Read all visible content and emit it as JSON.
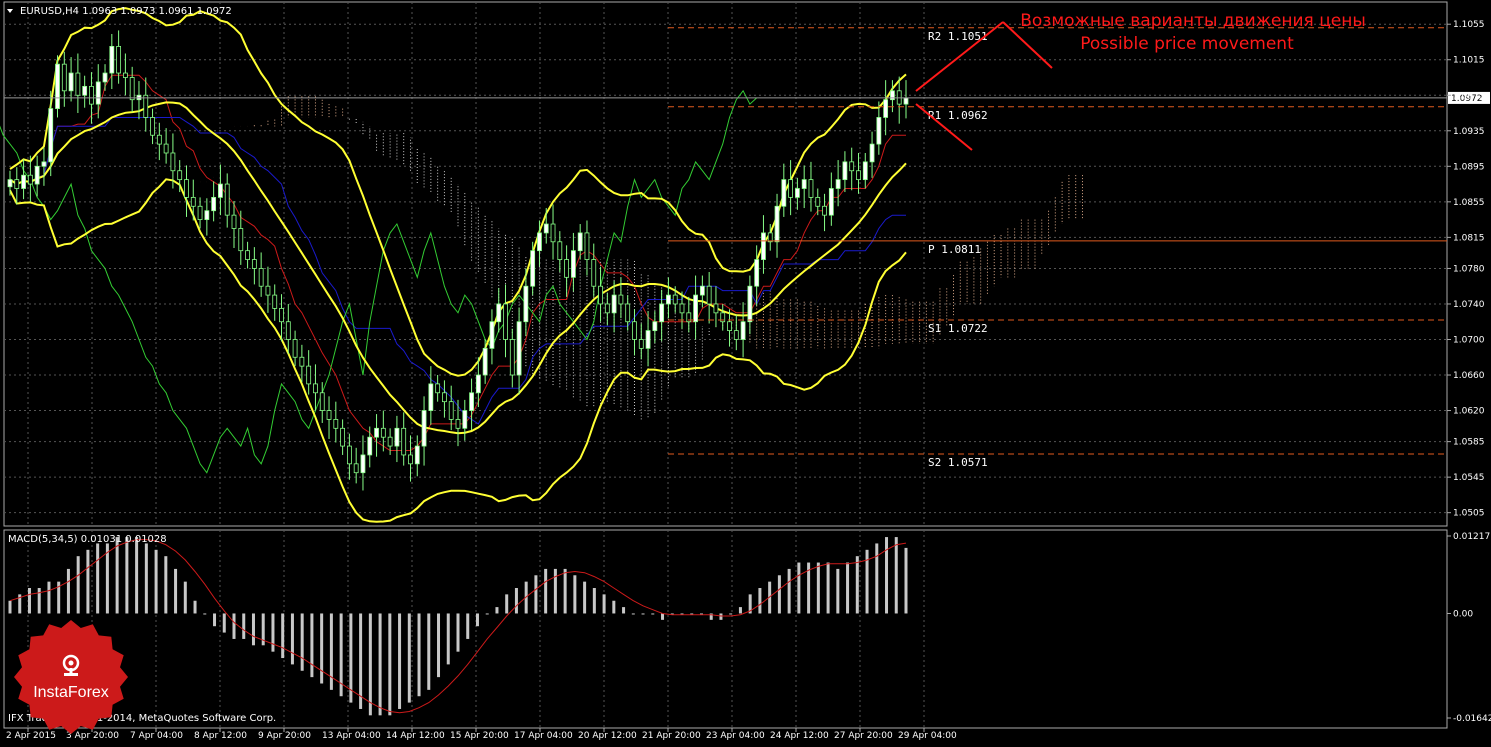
{
  "window": {
    "title": "EURUSD,H4  1.0963 1.0973 1.0961 1.0972",
    "copyright": "IFX Trader, © 2001-2014, MetaQuotes Software Corp."
  },
  "annotation": {
    "line1": "Возможные варианты движения цены",
    "line2": "Possible price movement",
    "color": "#ff1a1a"
  },
  "pivots": [
    {
      "label": "R2",
      "value": "1.1051",
      "price": 1.1051,
      "color": "#e05a1e",
      "style": "dash"
    },
    {
      "label": "R1",
      "value": "1.0962",
      "price": 1.0962,
      "color": "#e05a1e",
      "style": "dash"
    },
    {
      "label": "P",
      "value": "1.0811",
      "price": 1.0811,
      "color": "#e05a1e",
      "style": "solid"
    },
    {
      "label": "S1",
      "value": "1.0722",
      "price": 1.0722,
      "color": "#e05a1e",
      "style": "dash"
    },
    {
      "label": "S2",
      "value": "1.0571",
      "price": 1.0571,
      "color": "#e05a1e",
      "style": "dash"
    }
  ],
  "current_price": "1.0972",
  "macd": {
    "label": "MACD(5,34,5) 0.01031 0.01028",
    "y_ticks": [
      "0.01217",
      "0.00",
      "-0.01642"
    ]
  },
  "logo": {
    "text": "InstaForex",
    "color": "#cc1a1a"
  },
  "chart_data": {
    "type": "candlestick",
    "symbol": "EURUSD",
    "timeframe": "H4",
    "ylim": [
      1.049,
      1.108
    ],
    "y_ticks": [
      "1.1055",
      "1.1015",
      "1.0975",
      "1.0935",
      "1.0895",
      "1.0855",
      "1.0815",
      "1.0780",
      "1.0740",
      "1.0700",
      "1.0660",
      "1.0620",
      "1.0585",
      "1.0545",
      "1.0505"
    ],
    "x_ticks": [
      "2 Apr 2015",
      "3 Apr 20:00",
      "7 Apr 04:00",
      "8 Apr 12:00",
      "9 Apr 20:00",
      "13 Apr 04:00",
      "14 Apr 12:00",
      "15 Apr 20:00",
      "17 Apr 04:00",
      "20 Apr 12:00",
      "21 Apr 20:00",
      "23 Apr 04:00",
      "24 Apr 12:00",
      "27 Apr 20:00",
      "29 Apr 04:00"
    ],
    "close": [
      1.088,
      1.087,
      1.0885,
      1.0875,
      1.0895,
      1.09,
      1.096,
      1.101,
      1.098,
      1.1,
      1.0975,
      1.0985,
      1.0965,
      1.099,
      1.1,
      1.103,
      1.1,
      1.0995,
      1.097,
      1.0975,
      1.095,
      1.093,
      1.092,
      1.091,
      1.089,
      1.088,
      1.086,
      1.085,
      1.0835,
      1.0845,
      1.086,
      1.0875,
      1.084,
      1.0825,
      1.08,
      1.079,
      1.078,
      1.076,
      1.075,
      1.0735,
      1.072,
      1.07,
      1.068,
      1.067,
      1.065,
      1.064,
      1.062,
      1.061,
      1.06,
      1.058,
      1.056,
      1.055,
      1.057,
      1.059,
      1.06,
      1.059,
      1.058,
      1.06,
      1.057,
      1.056,
      1.058,
      1.062,
      1.065,
      1.064,
      1.063,
      1.061,
      1.06,
      1.062,
      1.064,
      1.066,
      1.069,
      1.072,
      1.074,
      1.07,
      1.066,
      1.072,
      1.076,
      1.08,
      1.082,
      1.083,
      1.081,
      1.079,
      1.077,
      1.08,
      1.082,
      1.079,
      1.076,
      1.074,
      1.073,
      1.075,
      1.074,
      1.072,
      1.07,
      1.069,
      1.071,
      1.072,
      1.074,
      1.075,
      1.074,
      1.073,
      1.072,
      1.075,
      1.076,
      1.074,
      1.073,
      1.072,
      1.071,
      1.07,
      1.072,
      1.076,
      1.079,
      1.082,
      1.081,
      1.085,
      1.088,
      1.086,
      1.087,
      1.088,
      1.086,
      1.085,
      1.084,
      1.087,
      1.088,
      1.09,
      1.089,
      1.088,
      1.09,
      1.092,
      1.095,
      1.097,
      1.098,
      1.0965,
      1.0972
    ],
    "indicators": [
      "Bollinger Bands (yellow)",
      "Ichimoku Kinko Hyo (red, blue, green, cloud)",
      "Pivot levels"
    ],
    "macd_histogram": [
      0.002,
      0.003,
      0.004,
      0.004,
      0.005,
      0.005,
      0.007,
      0.009,
      0.01,
      0.011,
      0.011,
      0.012,
      0.012,
      0.012,
      0.011,
      0.01,
      0.009,
      0.007,
      0.005,
      0.002,
      0.0,
      -0.002,
      -0.003,
      -0.004,
      -0.004,
      -0.005,
      -0.005,
      -0.006,
      -0.007,
      -0.008,
      -0.009,
      -0.01,
      -0.011,
      -0.012,
      -0.013,
      -0.014,
      -0.015,
      -0.016,
      -0.016,
      -0.016,
      -0.015,
      -0.014,
      -0.013,
      -0.012,
      -0.01,
      -0.008,
      -0.006,
      -0.004,
      -0.002,
      0.0,
      0.001,
      0.003,
      0.004,
      0.005,
      0.006,
      0.007,
      0.007,
      0.007,
      0.006,
      0.005,
      0.004,
      0.003,
      0.002,
      0.001,
      0.0,
      0.0,
      0.0,
      -0.001,
      0.0,
      0.0,
      0.0,
      0.0,
      -0.001,
      -0.001,
      0.0,
      0.001,
      0.003,
      0.004,
      0.005,
      0.006,
      0.007,
      0.008,
      0.008,
      0.008,
      0.008,
      0.007,
      0.008,
      0.009,
      0.01,
      0.011,
      0.012,
      0.012,
      0.0103
    ],
    "macd_ylim": [
      -0.01642,
      0.01217
    ]
  }
}
